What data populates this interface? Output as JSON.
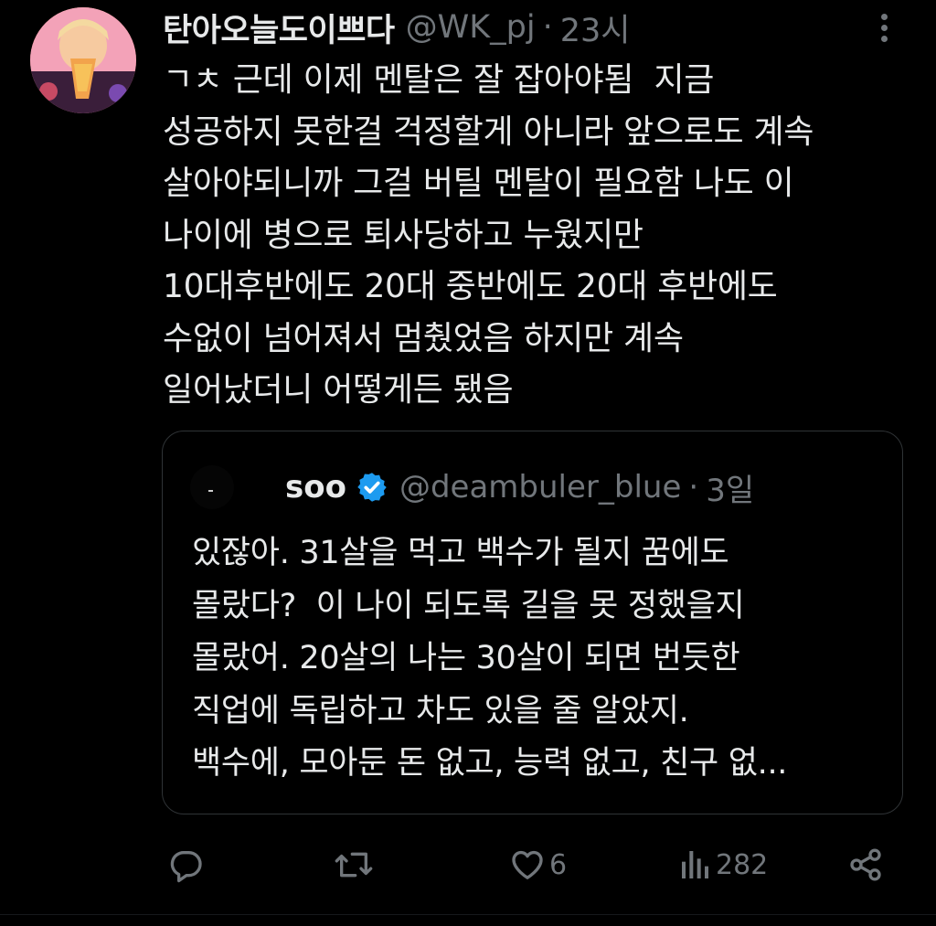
{
  "author": {
    "display_name": "탄아오늘도이쁘다",
    "handle": "@WK_pj",
    "separator": "·",
    "time": "23시"
  },
  "tweet": {
    "text": "ㄱㅊ 근데 이제 멘탈은 잘 잡아야됨  지금\n성공하지 못한걸 걱정할게 아니라 앞으로도 계속\n살아야되니까 그걸 버틸 멘탈이 필요함 나도 이\n나이에 병으로 퇴사당하고 누웠지만\n10대후반에도 20대 중반에도 20대 후반에도\n수없이 넘어져서 멈췄었음 하지만 계속\n일어났더니 어떻게든 됐음"
  },
  "quoted": {
    "display_name": "soo",
    "verified": true,
    "handle": "@deambuler_blue",
    "separator": "·",
    "time": "3일",
    "text": "있잖아. 31살을 먹고 백수가 될지 꿈에도\n몰랐다?  이 나이 되도록 길을 못 정했을지\n몰랐어. 20살의 나는 30살이 되면 번듯한\n직업에 독립하고 차도 있을 줄 알았지.\n백수에, 모아둔 돈 없고, 능력 없고, 친구 없..."
  },
  "actions": {
    "reply_icon": "reply-icon",
    "retweet_icon": "retweet-icon",
    "like_icon": "heart-icon",
    "like_count": "6",
    "views_icon": "views-icon",
    "views_count": "282",
    "share_icon": "share-icon"
  },
  "colors": {
    "background": "#000000",
    "text": "#e7e9ea",
    "muted": "#71767b",
    "border": "#2f3336",
    "verified": "#1d9bf0"
  }
}
